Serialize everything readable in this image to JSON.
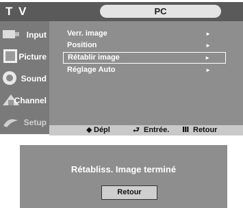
{
  "header": {
    "left_title": "T V",
    "section_title": "PC"
  },
  "sidebar": {
    "items": [
      {
        "label": "Input",
        "icon": "input-icon"
      },
      {
        "label": "Picture",
        "icon": "picture-icon"
      },
      {
        "label": "Sound",
        "icon": "sound-icon"
      },
      {
        "label": "Channel",
        "icon": "channel-icon"
      },
      {
        "label": "Setup",
        "icon": "setup-icon"
      }
    ]
  },
  "menu": {
    "items": [
      {
        "label": "Verr. image",
        "arrow": "►"
      },
      {
        "label": "Position",
        "arrow": "►"
      },
      {
        "label": "Rétablir image",
        "arrow": "►",
        "selected": true
      },
      {
        "label": "Réglage Auto",
        "arrow": "►"
      }
    ]
  },
  "footer": {
    "move_icon": "◆",
    "move_label": "Dépl",
    "enter_icon": "⮐",
    "enter_label": "Entrée.",
    "return_icon": "Ⅲ",
    "return_label": "Retour"
  },
  "dialog": {
    "message": "Rétabliss. Image terminé",
    "button_label": "Retour"
  }
}
